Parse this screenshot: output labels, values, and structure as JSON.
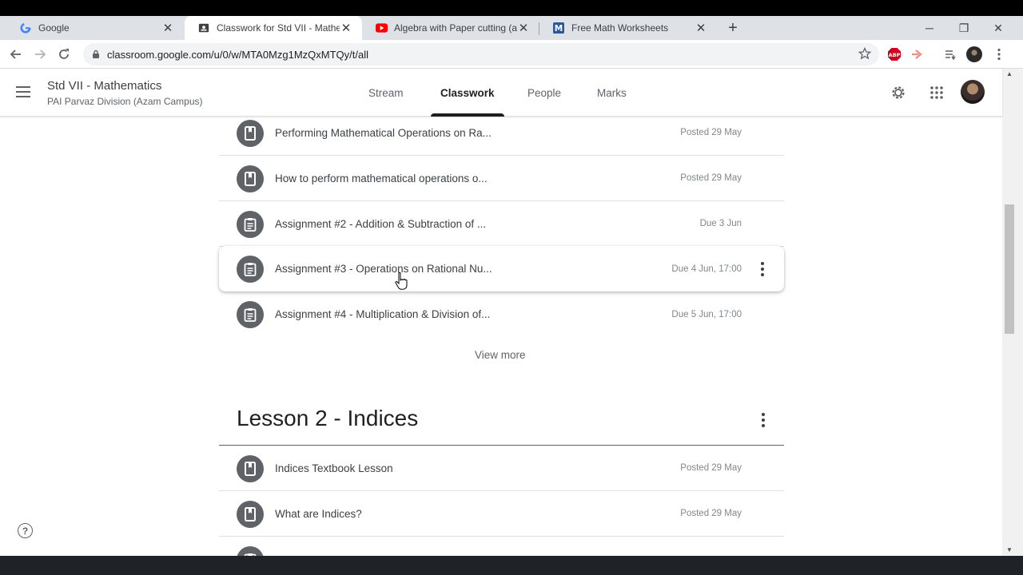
{
  "browser": {
    "tabs": [
      {
        "title": "Google",
        "favicon": "google-g-icon",
        "active": false
      },
      {
        "title": "Classwork for Std VII - Mathemat",
        "favicon": "classroom-icon",
        "active": true
      },
      {
        "title": "Algebra with Paper cutting (a+b)",
        "favicon": "youtube-icon",
        "active": false
      },
      {
        "title": "Free Math Worksheets",
        "favicon": "m-logo-icon",
        "active": false
      }
    ],
    "url": "classroom.google.com/u/0/w/MTA0Mzg1MzQxMTQy/t/all",
    "extensions": {
      "abp": "ABP"
    }
  },
  "classroom": {
    "class_name": "Std VII - Mathematics",
    "class_section": "PAI Parvaz Division (Azam Campus)",
    "nav": [
      "Stream",
      "Classwork",
      "People",
      "Marks"
    ],
    "active_nav": "Classwork"
  },
  "topic1": {
    "items": [
      {
        "title": "Performing Mathematical Operations on Ra...",
        "date": "Posted 29 May",
        "type": "material"
      },
      {
        "title": "How to perform mathematical operations o...",
        "date": "Posted 29 May",
        "type": "material"
      },
      {
        "title": "Assignment #2 - Addition & Subtraction of ...",
        "date": "Due 3 Jun",
        "type": "assignment"
      },
      {
        "title": "Assignment #3 - Operations on Rational Nu...",
        "date": "Due 4 Jun, 17:00",
        "type": "assignment"
      },
      {
        "title": "Assignment #4 - Multiplication & Division of...",
        "date": "Due 5 Jun, 17:00",
        "type": "assignment"
      }
    ],
    "view_more": "View more"
  },
  "topic2": {
    "title": "Lesson 2 - Indices",
    "items": [
      {
        "title": "Indices Textbook Lesson",
        "date": "Posted 29 May",
        "type": "material"
      },
      {
        "title": "What are Indices?",
        "date": "Posted 29 May",
        "type": "material"
      }
    ]
  },
  "help": "?",
  "colors": {
    "icon_bg": "#5f6368",
    "tabstrip": "#dee1e6",
    "accent": "#1e1e1e"
  }
}
